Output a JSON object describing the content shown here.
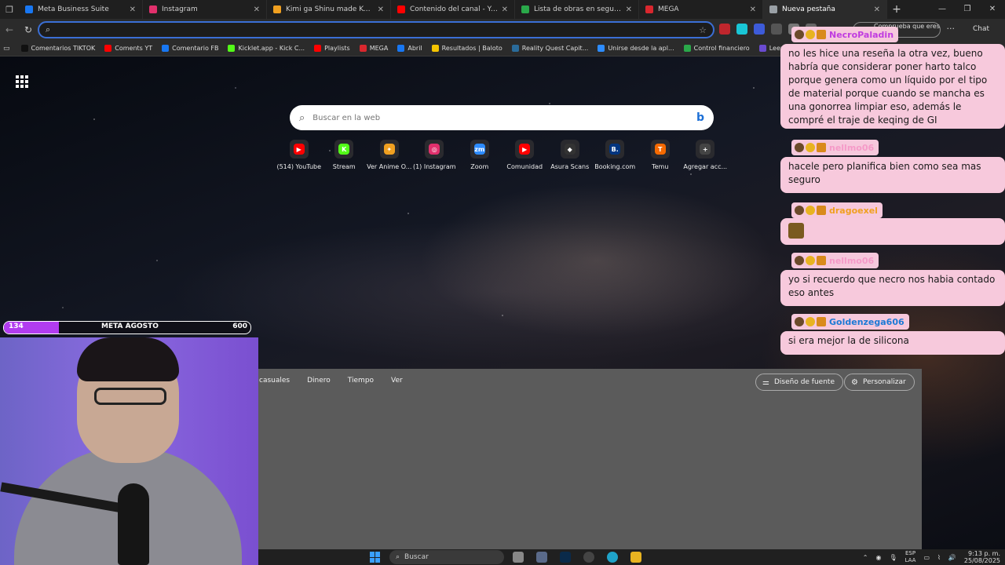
{
  "tabs": [
    {
      "label": "Meta Business Suite",
      "color": "#1877f2",
      "active": false
    },
    {
      "label": "Instagram",
      "color": "#e1306c",
      "active": false
    },
    {
      "label": "Kimi ga Shinu made Koi wo Shita",
      "color": "#f0a020",
      "active": false
    },
    {
      "label": "Contenido del canal - YouTube S",
      "color": "#ff0000",
      "active": false
    },
    {
      "label": "Lista de obras en seguimiento - I",
      "color": "#2aa84a",
      "active": false
    },
    {
      "label": "MEGA",
      "color": "#d9272e",
      "active": false
    },
    {
      "label": "Nueva pestaña",
      "color": "#9aa0a6",
      "active": true
    }
  ],
  "address": {
    "value": "",
    "prompt": "Comprueba que eres tú",
    "chat_label": "Chat"
  },
  "bookmarks": [
    {
      "label": "Comentarios TIKTOK",
      "color": "#111111"
    },
    {
      "label": "Coments YT",
      "color": "#ff0000"
    },
    {
      "label": "Comentario FB",
      "color": "#1877f2"
    },
    {
      "label": "Kicklet.app - Kick C...",
      "color": "#53fc18"
    },
    {
      "label": "Playlists",
      "color": "#ff0000"
    },
    {
      "label": "MEGA",
      "color": "#d9272e"
    },
    {
      "label": "Abril",
      "color": "#1877f2"
    },
    {
      "label": "Resultados | Baloto",
      "color": "#f5c400"
    },
    {
      "label": "Reality Quest Capit...",
      "color": "#2a6b9a"
    },
    {
      "label": "Unirse desde la apl...",
      "color": "#2d8cff"
    },
    {
      "label": "Control financiero",
      "color": "#2aa84a"
    },
    {
      "label": "Leer Me hi",
      "color": "#6a4bd0"
    }
  ],
  "search": {
    "placeholder": "Buscar en la web"
  },
  "quicklinks": [
    {
      "label": "(514) YouTube",
      "glyph": "▶",
      "color": "#ff0000"
    },
    {
      "label": "Stream",
      "glyph": "K",
      "color": "#53fc18"
    },
    {
      "label": "Ver Anime O...",
      "glyph": "✦",
      "color": "#f0a020"
    },
    {
      "label": "(1) Instagram",
      "glyph": "◎",
      "color": "#e1306c"
    },
    {
      "label": "Zoom",
      "glyph": "zm",
      "color": "#2d8cff"
    },
    {
      "label": "Comunidad",
      "glyph": "▶",
      "color": "#ff0000"
    },
    {
      "label": "Asura Scans",
      "glyph": "◆",
      "color": "#333333"
    },
    {
      "label": "Booking.com",
      "glyph": "B.",
      "color": "#003580"
    },
    {
      "label": "Temu",
      "glyph": "T",
      "color": "#f56a00"
    },
    {
      "label": "Agregar acc...",
      "glyph": "+",
      "color": "#444444"
    }
  ],
  "feed": {
    "tabs": [
      "casuales",
      "Dinero",
      "Tiempo",
      "Ver"
    ],
    "font_design": "Diseño de fuente",
    "personalize": "Personalizar"
  },
  "goal": {
    "current": "134",
    "title": "META AGOSTO",
    "target": "600",
    "progress": 0.223,
    "color": "#b23cf0"
  },
  "chat": [
    {
      "user": "NecroPaladin",
      "user_color": "#c03ce0",
      "text": "no les hice una reseña la otra vez, bueno habría que considerar poner harto talco porque genera como un líquido por el tipo de material porque cuando se mancha es una gonorrea limpiar eso, además le compré el traje de keqing de GI"
    },
    {
      "user": "nellmo06",
      "user_color": "#f59ac8",
      "text": "hacele pero planifica bien como sea mas seguro"
    },
    {
      "user": "dragoexel",
      "user_color": "#f0a020",
      "text": ""
    },
    {
      "user": "nellmo06",
      "user_color": "#f59ac8",
      "text": "yo si recuerdo que necro nos habia contado eso antes"
    },
    {
      "user": "Goldenzega606",
      "user_color": "#1c7ad6",
      "text": "si era mejor la de silicona"
    }
  ],
  "taskbar": {
    "search_placeholder": "Buscar",
    "lang": "ESP",
    "lang_sub": "LAA",
    "time": "9:13 p. m.",
    "date": "25/08/2025"
  }
}
